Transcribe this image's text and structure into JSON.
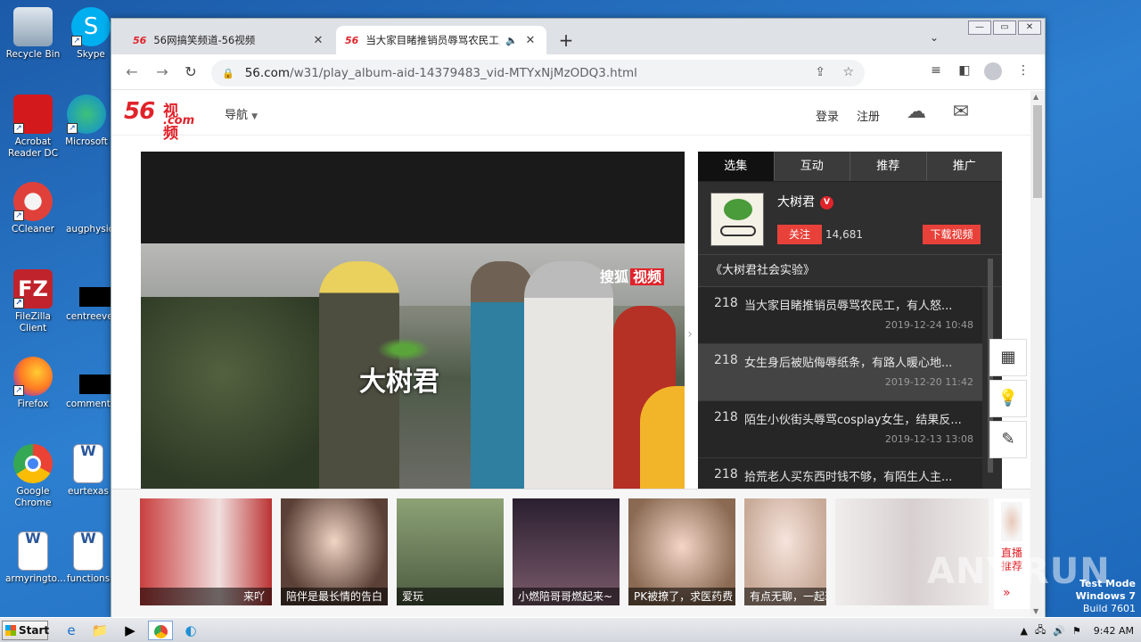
{
  "desktop": {
    "icons": [
      {
        "label": "Recycle Bin",
        "color": "#9fb4c8"
      },
      {
        "label": "Skype",
        "color": "#00aff0"
      },
      {
        "label": "Acrobat Reader DC",
        "color": "#d4191c"
      },
      {
        "label": "Microsoft",
        "color": "#0f8bd6"
      },
      {
        "label": "CCleaner",
        "color": "#e0403a"
      },
      {
        "label": "augphysic",
        "color": "#1b5aa8"
      },
      {
        "label": "FileZilla Client",
        "color": "#c0232b"
      },
      {
        "label": "centreeve",
        "color": "#000000"
      },
      {
        "label": "Firefox",
        "color": "#ff7a22"
      },
      {
        "label": "commentf",
        "color": "#000000"
      },
      {
        "label": "Google Chrome",
        "color": "#4285f4"
      },
      {
        "label": "eurtexas",
        "color": "#ffffff"
      },
      {
        "label": "armyringto...",
        "color": "#ffffff"
      },
      {
        "label": "functions",
        "color": "#ffffff"
      }
    ]
  },
  "browser": {
    "tabs": [
      {
        "favicon": "56",
        "title": "56网搞笑频道-56视频",
        "active": false
      },
      {
        "favicon": "56",
        "title": "当大家目睹推销员辱骂农民工,",
        "active": true,
        "audio_icon": "speaker-icon"
      }
    ],
    "new_tab": "+",
    "url_host": "56.com",
    "url_path": "/w31/play_album-aid-14379483_vid-MTYxNjMzODQ3.html"
  },
  "site": {
    "logo_num": "56",
    "logo_cn": "视频",
    "logo_com": ".com",
    "nav_label": "导航",
    "login": "登录",
    "register": "注册"
  },
  "player": {
    "watermark_a": "搜狐",
    "watermark_b": "视频",
    "overlay_logo": "大树君"
  },
  "panel": {
    "tabs": [
      "选集",
      "互动",
      "推荐",
      "推广"
    ],
    "active_tab": 0,
    "uploader": "大树君",
    "verified_badge": "V",
    "follow": "关注",
    "followers": "14,681",
    "download": "下载视频",
    "album": "《大树君社会实验》",
    "episodes": [
      {
        "num": "218",
        "title": "当大家目睹推销员辱骂农民工，有人怒...",
        "date": "2019-12-24 10:48"
      },
      {
        "num": "218",
        "title": "女生身后被贴侮辱纸条，有路人暖心地...",
        "date": "2019-12-20 11:42"
      },
      {
        "num": "218",
        "title": "陌生小伙街头辱骂cosplay女生，结果反...",
        "date": "2019-12-13 13:08"
      },
      {
        "num": "218",
        "title": "拾荒老人买东西时钱不够，有陌生人主...",
        "date": ""
      }
    ]
  },
  "ads": [
    {
      "caption": "来吖",
      "color": "#c94040"
    },
    {
      "caption": "陪伴是最长情的告白",
      "color": "#8a7060"
    },
    {
      "caption": "爱玩",
      "color": "#6a7d5a"
    },
    {
      "caption": "小燃陪哥哥燃起来~",
      "color": "#4a3a4e"
    },
    {
      "caption": "PK被撩了，求医药费",
      "color": "#b9a08a"
    },
    {
      "caption": "有点无聊，一起玩",
      "color": "#d8c7bd"
    },
    {
      "caption": "",
      "color": "#e8e4e4"
    }
  ],
  "live": {
    "label": "直播推荐",
    "arrow": "»"
  },
  "watermark": "ANY.RUN",
  "testmode": {
    "line1": "Test Mode",
    "line2": "Windows 7",
    "line3": "Build 7601"
  },
  "taskbar": {
    "start": "Start",
    "time": "9:42 AM"
  }
}
